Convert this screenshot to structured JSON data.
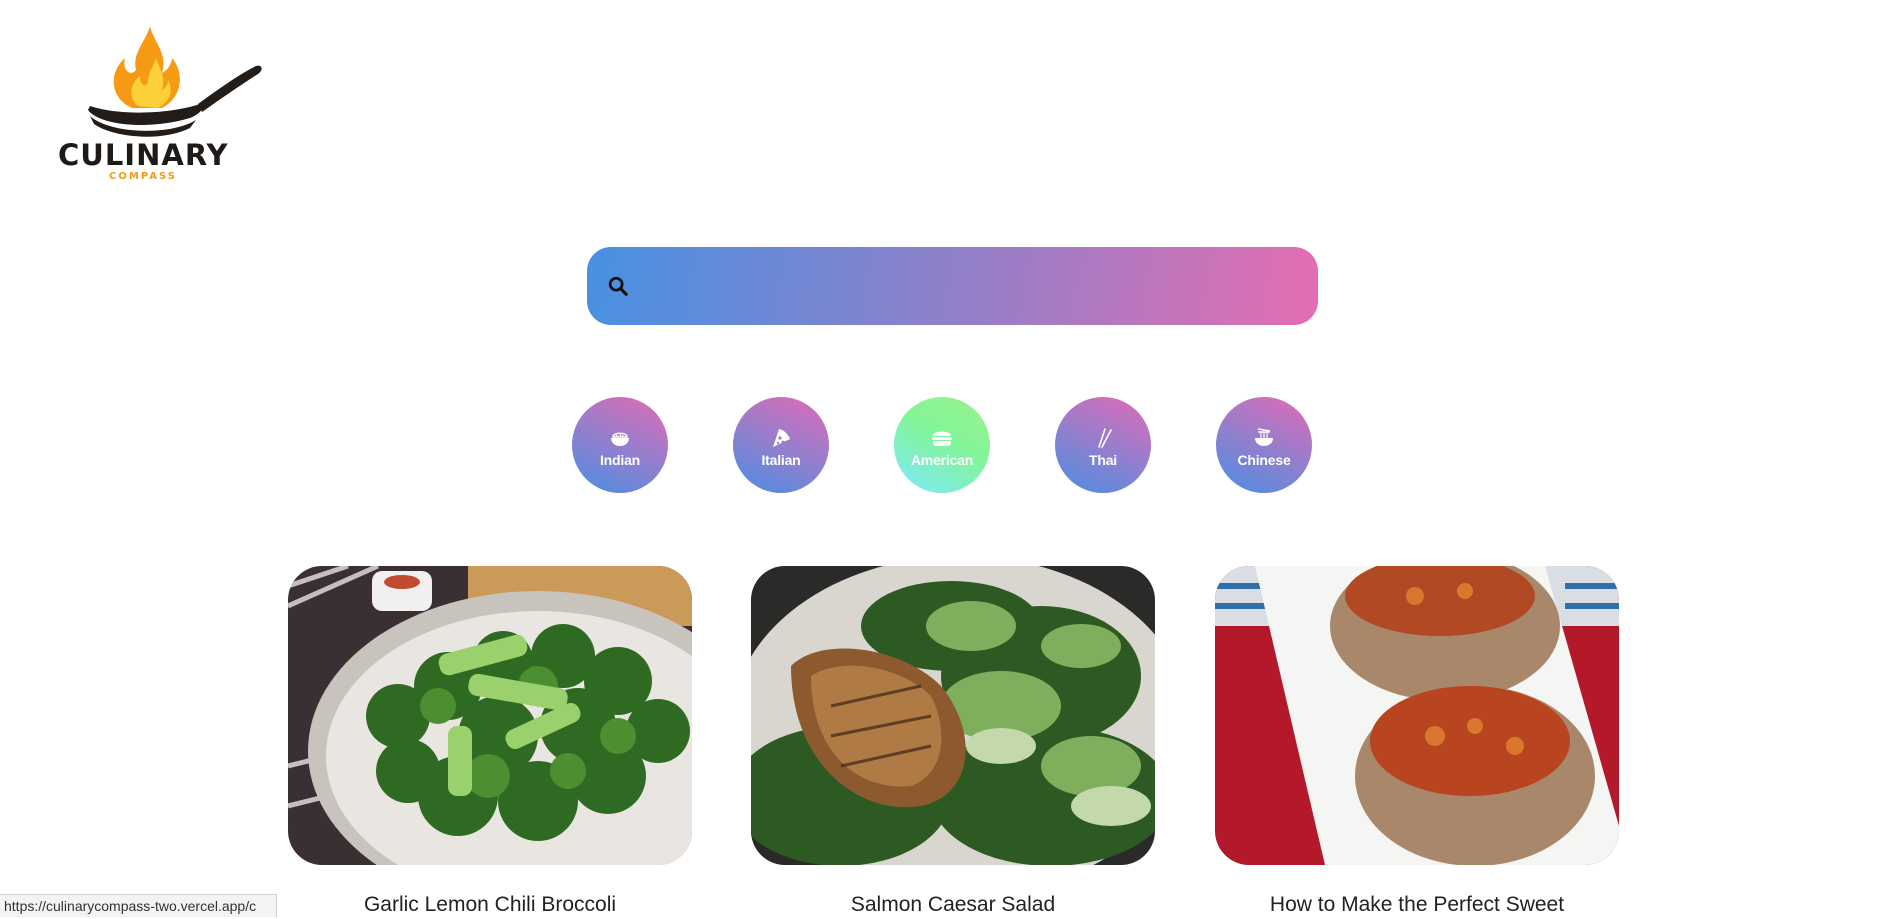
{
  "logo": {
    "word": "CULINARY",
    "sub": "COMPASS"
  },
  "search": {
    "placeholder": "",
    "value": "",
    "icon": "search-icon"
  },
  "colors": {
    "search_gradient": [
      "#4791e2",
      "#8f80c9",
      "#e56db1"
    ],
    "category_default": [
      "#4a8ee3",
      "#8d80cf",
      "#e26ab5"
    ],
    "category_active": [
      "#7fe7ff",
      "#82f59a",
      "#9bf28a"
    ]
  },
  "categories": [
    {
      "label": "Indian",
      "icon": "rice-bowl-icon",
      "active": false
    },
    {
      "label": "Italian",
      "icon": "pizza-icon",
      "active": false
    },
    {
      "label": "American",
      "icon": "burger-icon",
      "active": true
    },
    {
      "label": "Thai",
      "icon": "chopsticks-icon",
      "active": false
    },
    {
      "label": "Chinese",
      "icon": "noodle-bowl-icon",
      "active": false
    }
  ],
  "recipes": [
    {
      "title": "Garlic Lemon Chili Broccoli"
    },
    {
      "title": "Salmon Caesar Salad"
    },
    {
      "title": "How to Make the Perfect Sweet"
    }
  ],
  "status_bar": {
    "url": "https://culinarycompass-two.vercel.app/c"
  }
}
